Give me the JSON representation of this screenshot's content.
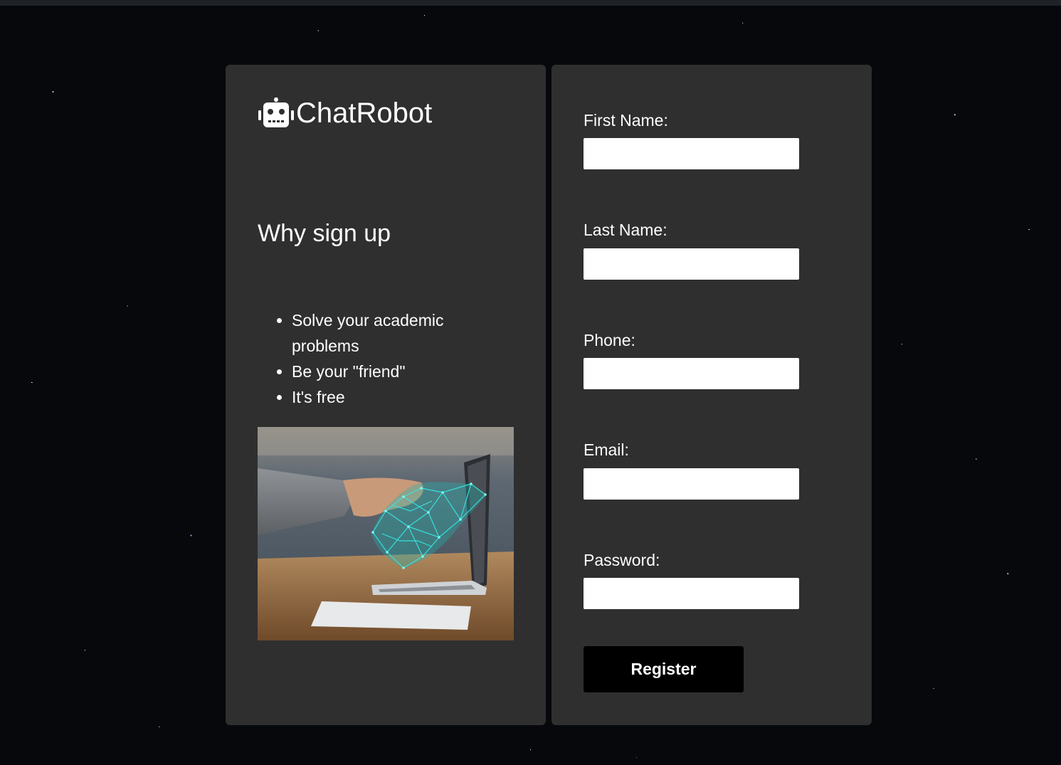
{
  "brand": {
    "name": "ChatRobot",
    "icon": "robot-icon"
  },
  "why": {
    "heading": "Why sign up",
    "benefits": [
      "Solve your academic problems",
      "Be your \"friend\"",
      "It's free"
    ],
    "image_alt": "handshake-image"
  },
  "form": {
    "fields": {
      "first_name": {
        "label": "First Name:",
        "value": ""
      },
      "last_name": {
        "label": "Last Name:",
        "value": ""
      },
      "phone": {
        "label": "Phone:",
        "value": ""
      },
      "email": {
        "label": "Email:",
        "value": ""
      },
      "password": {
        "label": "Password:",
        "value": ""
      }
    },
    "submit_label": "Register"
  },
  "colors": {
    "panel": "#2f2f2f",
    "button": "#000000",
    "accent": "#34e6e0"
  }
}
